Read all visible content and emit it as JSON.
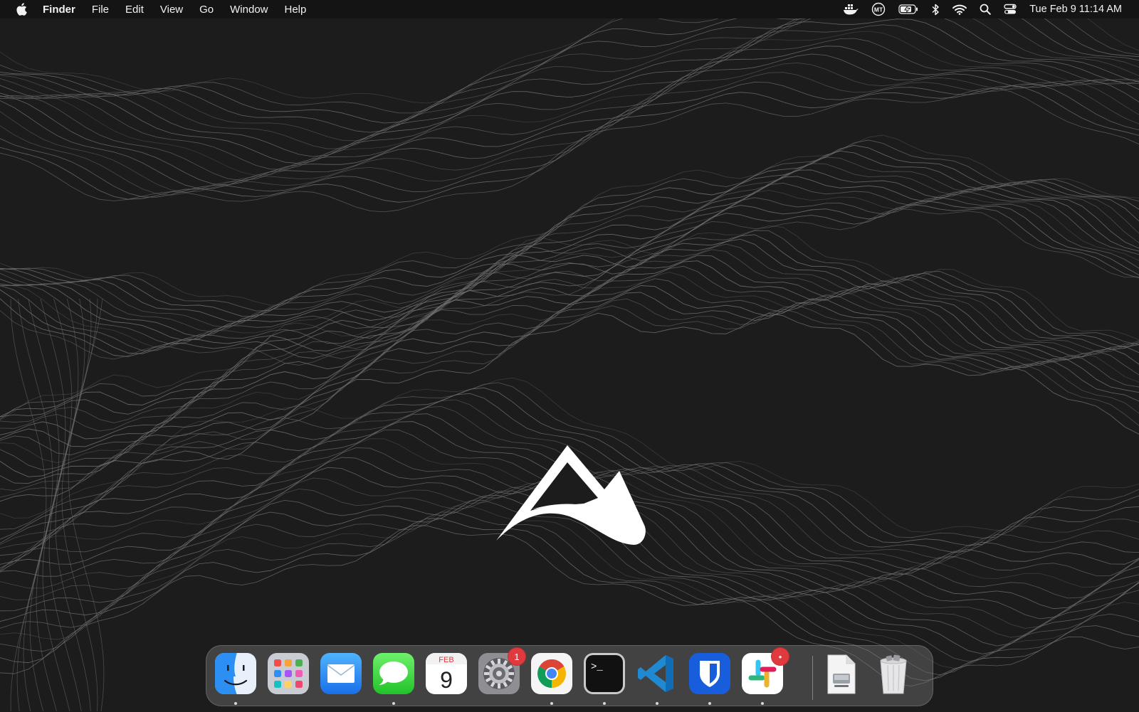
{
  "menubar": {
    "app_name": "Finder",
    "menus": [
      "File",
      "Edit",
      "View",
      "Go",
      "Window",
      "Help"
    ],
    "clock": "Tue Feb 9  11:14 AM",
    "status_icons": [
      "docker-icon",
      "mt-account-icon",
      "battery-charging-icon",
      "bluetooth-icon",
      "wifi-icon",
      "spotlight-search-icon",
      "control-center-icon"
    ],
    "account_initials": "MT"
  },
  "wallpaper": {
    "description_icon": "mountain-logo-icon",
    "background_color": "#1c1c1c",
    "contour_color": "#9a9a9a"
  },
  "dock": {
    "apps": [
      {
        "name": "Finder",
        "icon": "finder-icon",
        "running": true
      },
      {
        "name": "Launchpad",
        "icon": "launchpad-icon",
        "running": false
      },
      {
        "name": "Mail",
        "icon": "mail-icon",
        "running": false
      },
      {
        "name": "Messages",
        "icon": "messages-icon",
        "running": true
      },
      {
        "name": "Calendar",
        "icon": "calendar-icon",
        "running": false,
        "month": "FEB",
        "day": "9"
      },
      {
        "name": "System Preferences",
        "icon": "system-preferences-icon",
        "running": false,
        "badge": "1"
      },
      {
        "name": "Google Chrome",
        "icon": "chrome-icon",
        "running": true
      },
      {
        "name": "Terminal",
        "icon": "terminal-icon",
        "running": true,
        "prompt": ">_"
      },
      {
        "name": "Visual Studio Code",
        "icon": "vscode-icon",
        "running": true
      },
      {
        "name": "Bitwarden",
        "icon": "bitwarden-icon",
        "running": true
      },
      {
        "name": "Slack",
        "icon": "slack-icon",
        "running": true,
        "badge": "•"
      }
    ],
    "others": [
      {
        "name": "Disk Image",
        "icon": "disk-image-icon"
      },
      {
        "name": "Trash",
        "icon": "trash-icon"
      }
    ]
  }
}
